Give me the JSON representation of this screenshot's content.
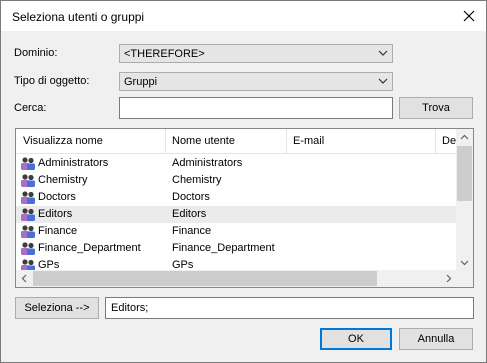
{
  "dialog": {
    "title": "Seleziona utenti o gruppi"
  },
  "form": {
    "domain_label": "Dominio:",
    "domain_value": "<THEREFORE>",
    "object_type_label": "Tipo di oggetto:",
    "object_type_value": "Gruppi",
    "search_label": "Cerca:",
    "search_value": "",
    "find_button": "Trova"
  },
  "list": {
    "columns": [
      "Visualizza nome",
      "Nome utente",
      "E-mail",
      "Des"
    ],
    "rows": [
      {
        "display_name": "Administrators",
        "user_name": "Administrators",
        "selected": false
      },
      {
        "display_name": "Chemistry",
        "user_name": "Chemistry",
        "selected": false
      },
      {
        "display_name": "Doctors",
        "user_name": "Doctors",
        "selected": false
      },
      {
        "display_name": "Editors",
        "user_name": "Editors",
        "selected": true
      },
      {
        "display_name": "Finance",
        "user_name": "Finance",
        "selected": false
      },
      {
        "display_name": "Finance_Department",
        "user_name": "Finance_Department",
        "selected": false
      },
      {
        "display_name": "GPs",
        "user_name": "GPs",
        "selected": false
      }
    ],
    "row_icon": "user-group-icon"
  },
  "selection": {
    "select_button": "Seleziona -->",
    "selected_value": "Editors;"
  },
  "footer": {
    "ok_button": "OK",
    "cancel_button": "Annulla"
  },
  "colors": {
    "default_button_border": "#0078d7",
    "selected_row": "#ebebeb",
    "dialog_background": "#f0f0f0"
  }
}
